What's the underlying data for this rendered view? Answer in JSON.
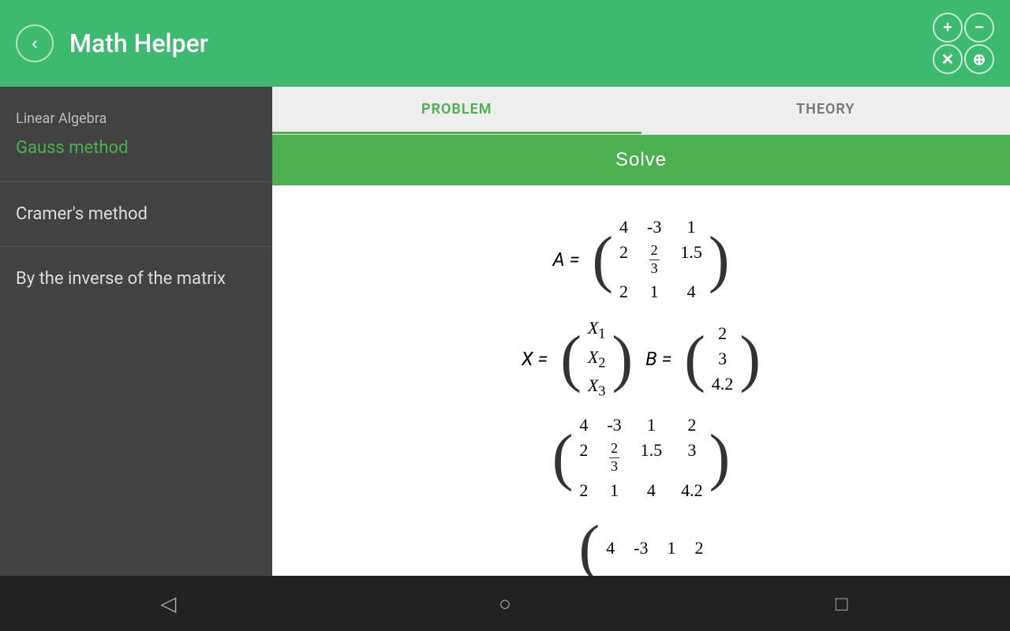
{
  "app": {
    "title": "Math Helper",
    "back_label": "‹"
  },
  "zoom": {
    "plus_label": "+",
    "minus_label": "−",
    "close_label": "✕",
    "circle_plus_label": "⊕"
  },
  "tabs": [
    {
      "id": "problem",
      "label": "PROBLEM",
      "active": true
    },
    {
      "id": "theory",
      "label": "THEORY",
      "active": false
    }
  ],
  "solve_button": "Solve",
  "sidebar": {
    "section": "Linear Algebra",
    "active_item": "Gauss method",
    "items": [
      {
        "label": "Cramer's method"
      },
      {
        "label": "By the inverse of the matrix"
      }
    ]
  },
  "bottom_nav": {
    "back": "◁",
    "home": "○",
    "square": "□"
  }
}
